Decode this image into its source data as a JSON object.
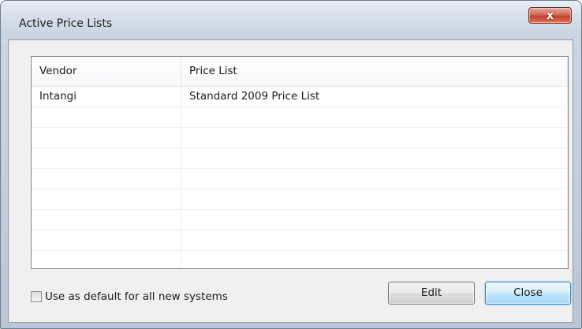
{
  "window": {
    "title": "Active Price Lists",
    "close_glyph": "x"
  },
  "grid": {
    "columns": [
      "Vendor",
      "Price List"
    ],
    "rows": [
      [
        "Intangi",
        "Standard 2009 Price List"
      ],
      [
        "",
        ""
      ],
      [
        "",
        ""
      ],
      [
        "",
        ""
      ],
      [
        "",
        ""
      ],
      [
        "",
        ""
      ],
      [
        "",
        ""
      ],
      [
        "",
        ""
      ],
      [
        "",
        ""
      ]
    ]
  },
  "footer": {
    "default_checkbox_label": "Use as default for all new systems",
    "default_checkbox_checked": false,
    "edit_label": "Edit",
    "close_label": "Close"
  },
  "colors": {
    "close_button_accent": "#c0422b",
    "focused_button_border": "#3c7fb1"
  }
}
